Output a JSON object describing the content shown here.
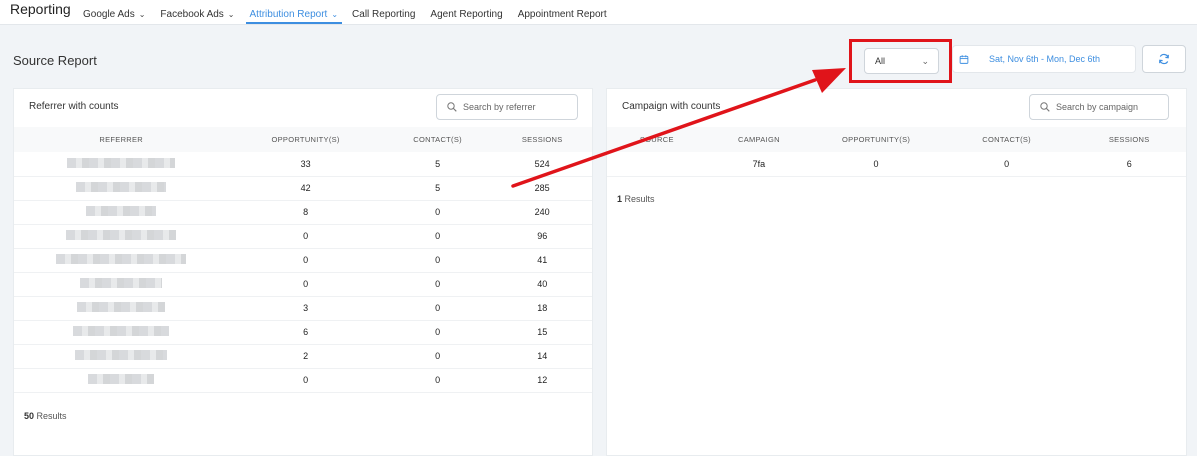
{
  "nav": {
    "brand": "Reporting",
    "tabs": [
      {
        "label": "Google Ads",
        "has_chevron": true
      },
      {
        "label": "Facebook Ads",
        "has_chevron": true
      },
      {
        "label": "Attribution Report",
        "has_chevron": true,
        "active": true
      },
      {
        "label": "Call Reporting"
      },
      {
        "label": "Agent Reporting"
      },
      {
        "label": "Appointment Report"
      }
    ]
  },
  "page": {
    "title": "Source Report"
  },
  "filters": {
    "select_value": "All",
    "date_range": "Sat, Nov 6th - Mon, Dec 6th"
  },
  "referrer_card": {
    "title": "Referrer with counts",
    "search_placeholder": "Search by referrer",
    "columns": [
      "REFERRER",
      "OPPORTUNITY(S)",
      "CONTACT(S)",
      "SESSIONS"
    ],
    "rows": [
      {
        "opportunities": "33",
        "contacts": "5",
        "sessions": "524"
      },
      {
        "opportunities": "42",
        "contacts": "5",
        "sessions": "285"
      },
      {
        "opportunities": "8",
        "contacts": "0",
        "sessions": "240"
      },
      {
        "opportunities": "0",
        "contacts": "0",
        "sessions": "96"
      },
      {
        "opportunities": "0",
        "contacts": "0",
        "sessions": "41"
      },
      {
        "opportunities": "0",
        "contacts": "0",
        "sessions": "40"
      },
      {
        "opportunities": "3",
        "contacts": "0",
        "sessions": "18"
      },
      {
        "opportunities": "6",
        "contacts": "0",
        "sessions": "15"
      },
      {
        "opportunities": "2",
        "contacts": "0",
        "sessions": "14"
      },
      {
        "opportunities": "0",
        "contacts": "0",
        "sessions": "12"
      }
    ],
    "results_count": "50",
    "results_label": "Results"
  },
  "campaign_card": {
    "title": "Campaign with counts",
    "search_placeholder": "Search by campaign",
    "columns": [
      "SOURCE",
      "CAMPAIGN",
      "OPPORTUNITY(S)",
      "CONTACT(S)",
      "SESSIONS"
    ],
    "rows": [
      {
        "source": "",
        "campaign": "7fa",
        "opportunities": "0",
        "contacts": "0",
        "sessions": "6"
      }
    ],
    "results_count": "1",
    "results_label": "Results"
  },
  "colors": {
    "accent": "#3d8ee0",
    "annotation": "#e0141a"
  },
  "icons": {
    "calendar": "calendar-icon",
    "refresh": "refresh-icon",
    "search": "search-icon"
  }
}
